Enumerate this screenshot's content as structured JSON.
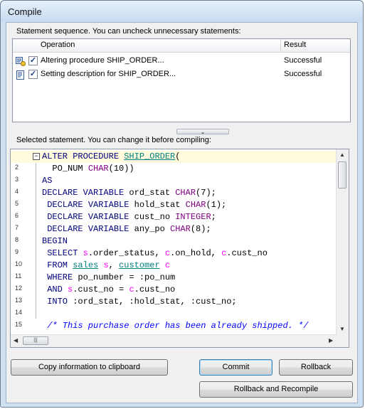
{
  "window": {
    "title": "Compile"
  },
  "statements": {
    "label": "Statement sequence. You can uncheck unnecessary statements:",
    "columns": {
      "operation": "Operation",
      "result": "Result"
    },
    "rows": [
      {
        "icon": "procedure-icon",
        "checked": true,
        "operation": "Altering procedure SHIP_ORDER...",
        "result": "Successful"
      },
      {
        "icon": "description-icon",
        "checked": true,
        "operation": "Setting description for SHIP_ORDER...",
        "result": "Successful"
      }
    ]
  },
  "splitter": {
    "glyph": "⌄"
  },
  "editor": {
    "label": "Selected statement. You can change it before compiling:",
    "lines": [
      {
        "num": "",
        "text": "ALTER PROCEDURE SHIP_ORDER("
      },
      {
        "num": "2",
        "text": "  PO_NUM CHAR(10))"
      },
      {
        "num": "3",
        "text": "AS"
      },
      {
        "num": "4",
        "text": "DECLARE VARIABLE ord_stat CHAR(7);"
      },
      {
        "num": "5",
        "text": " DECLARE VARIABLE hold_stat CHAR(1);"
      },
      {
        "num": "6",
        "text": " DECLARE VARIABLE cust_no INTEGER;"
      },
      {
        "num": "7",
        "text": " DECLARE VARIABLE any_po CHAR(8);"
      },
      {
        "num": "8",
        "text": "BEGIN"
      },
      {
        "num": "9",
        "text": " SELECT s.order_status, c.on_hold, c.cust_no"
      },
      {
        "num": "10",
        "text": " FROM sales s, customer c"
      },
      {
        "num": "11",
        "text": " WHERE po_number = :po_num"
      },
      {
        "num": "12",
        "text": " AND s.cust_no = c.cust_no"
      },
      {
        "num": "13",
        "text": " INTO :ord_stat, :hold_stat, :cust_no;"
      },
      {
        "num": "14",
        "text": ""
      },
      {
        "num": "15",
        "text": " /* This purchase order has been already shipped. */"
      }
    ]
  },
  "buttons": {
    "copy": "Copy information to clipboard",
    "commit": "Commit",
    "rollback": "Rollback",
    "rollback_recompile": "Rollback and Recompile"
  },
  "colors": {
    "keyword": "#000080",
    "type": "#800080",
    "table": "#008080",
    "alias": "#ff00ff",
    "comment": "#0000ff"
  }
}
